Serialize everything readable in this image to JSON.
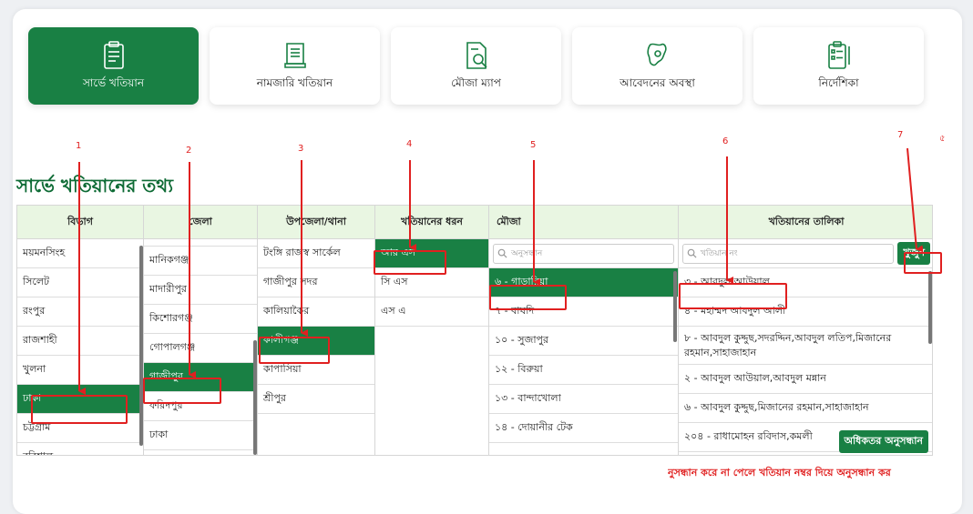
{
  "tabs": [
    {
      "label": "সার্ভে খতিয়ান",
      "icon": "survey-clipboard-icon",
      "active": true
    },
    {
      "label": "নামজারি খতিয়ান",
      "icon": "scroll-document-icon",
      "active": false
    },
    {
      "label": "মৌজা ম্যাপ",
      "icon": "map-search-icon",
      "active": false
    },
    {
      "label": "আবেদনের অবস্থা",
      "icon": "map-location-icon",
      "active": false
    },
    {
      "label": "নির্দেশিকা",
      "icon": "guide-checklist-icon",
      "active": false
    }
  ],
  "page_title": "সার্ভে খতিয়ানের তথ্য",
  "columns": {
    "division": {
      "header": "বিভাগ",
      "items": [
        "ময়মনসিংহ",
        "সিলেট",
        "রংপুর",
        "রাজশাহী",
        "খুলনা",
        "ঢাকা",
        "চট্টগ্রাম",
        "বরিশাল"
      ],
      "selected": "ঢাকা"
    },
    "district": {
      "header": "জেলা",
      "items": [
        "মানিকগঞ্জ",
        "মাদারীপুর",
        "কিশোরগঞ্জ",
        "গোপালগঞ্জ",
        "গাজীপুর",
        "ফরিদপুর",
        "ঢাকা"
      ],
      "selected": "গাজীপুর"
    },
    "upazila": {
      "header": "উপজেলা/থানা",
      "items": [
        "টংঙ্গি রাজস্ব সার্কেল",
        "গাজীপুর সদর",
        "কালিয়াকৈর",
        "কালীগঞ্জ",
        "কাপাসিয়া",
        "শ্রীপুর"
      ],
      "selected": "কালীগঞ্জ"
    },
    "khatian_type": {
      "header": "খতিয়ানের ধরন",
      "items": [
        "আর এস",
        "সি এস",
        "এস এ"
      ],
      "selected": "আর এস"
    },
    "mouza": {
      "header": "মৌজা",
      "search_placeholder": "অনুসন্ধান",
      "items": [
        "৬ - গাড়ারিয়া",
        "৭ - বাঘদি",
        "১০ - সুজাপুর",
        "১২ - বিরুয়া",
        "১৩ - বান্দাখোলা",
        "১৪ - দোয়ানীর টেক"
      ],
      "selected": "৬ - গাড়ারিয়া"
    },
    "khatian_list": {
      "header": "খতিয়ানের তালিকা",
      "search_placeholder": "খতিয়ান নং",
      "search_button": "খুজুন",
      "items": [
        "৩ - আবদুল আউয়াল",
        "৪ - মহাম্মদ আবদুল আলী",
        "৮ - আবদুল কুদ্দুছ,সদরদ্দিন,আবদুল লতিপ,মিজানের রহমান,সাহাজাহান",
        "২ - আবদুল আউয়াল,আবদুল মন্নান",
        "৬ - আবদুল কুদ্দুছ,মিজানের রহমান,সাহাজাহান",
        "২০৪ - রাধামোহন রবিদাস,কমলী"
      ],
      "advanced_button": "অধিকতর অনুসন্ধান"
    }
  },
  "annotations": [
    "1",
    "2",
    "3",
    "4",
    "5",
    "6",
    "7",
    "৫"
  ],
  "footer_note": "নুসন্ধান করে না পেলে খতিয়ান নম্বর দিয়ে অনুসন্ধান কর",
  "colors": {
    "brand_green": "#198044",
    "header_bg": "#e9f6e2",
    "annotation_red": "#e02020",
    "title_green": "#0e6b35"
  }
}
